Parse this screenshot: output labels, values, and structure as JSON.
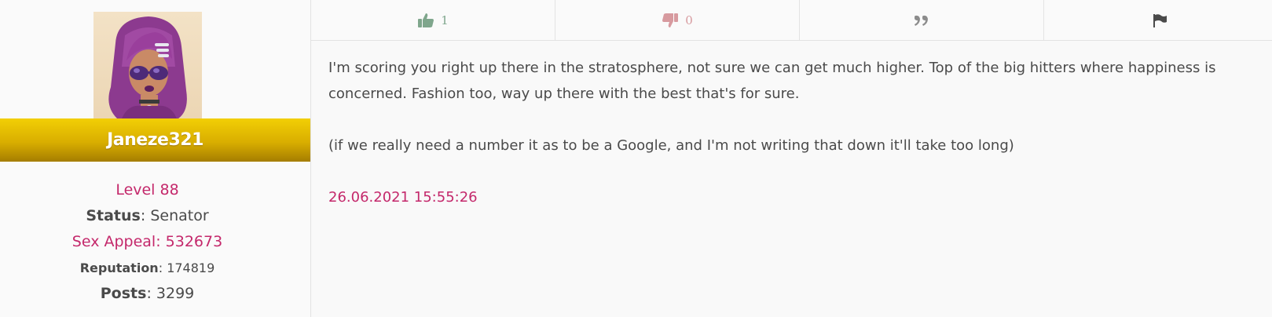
{
  "user": {
    "username": "Janeze321",
    "level": "Level 88",
    "status_label": "Status",
    "status_value": "Senator",
    "sex_appeal_label": "Sex Appeal",
    "sex_appeal_value": "532673",
    "reputation_label": "Reputation",
    "reputation_value": "174819",
    "posts_label": "Posts",
    "posts_value": "3299",
    "colon": ":"
  },
  "toolbar": {
    "upvote_count": "1",
    "downvote_count": "0",
    "icons": [
      "thumbs-up-icon",
      "thumbs-down-icon",
      "quote-icon",
      "flag-icon"
    ]
  },
  "post": {
    "paragraph1": "I'm scoring you right up there in the stratosphere, not sure we can get much higher. Top of the big hitters where happiness is concerned. Fashion too, way up there with the best that's for sure.",
    "paragraph2": "(if we really need a number it as to be a Google, and I'm not writing that down it'll take too long)",
    "timestamp": "26.06.2021 15:55:26"
  },
  "colors": {
    "accent_pink": "#c4286b",
    "gold_bar": "#e0b700",
    "upvote_green": "#7fa68c",
    "downvote_pink": "#d79a9f"
  }
}
